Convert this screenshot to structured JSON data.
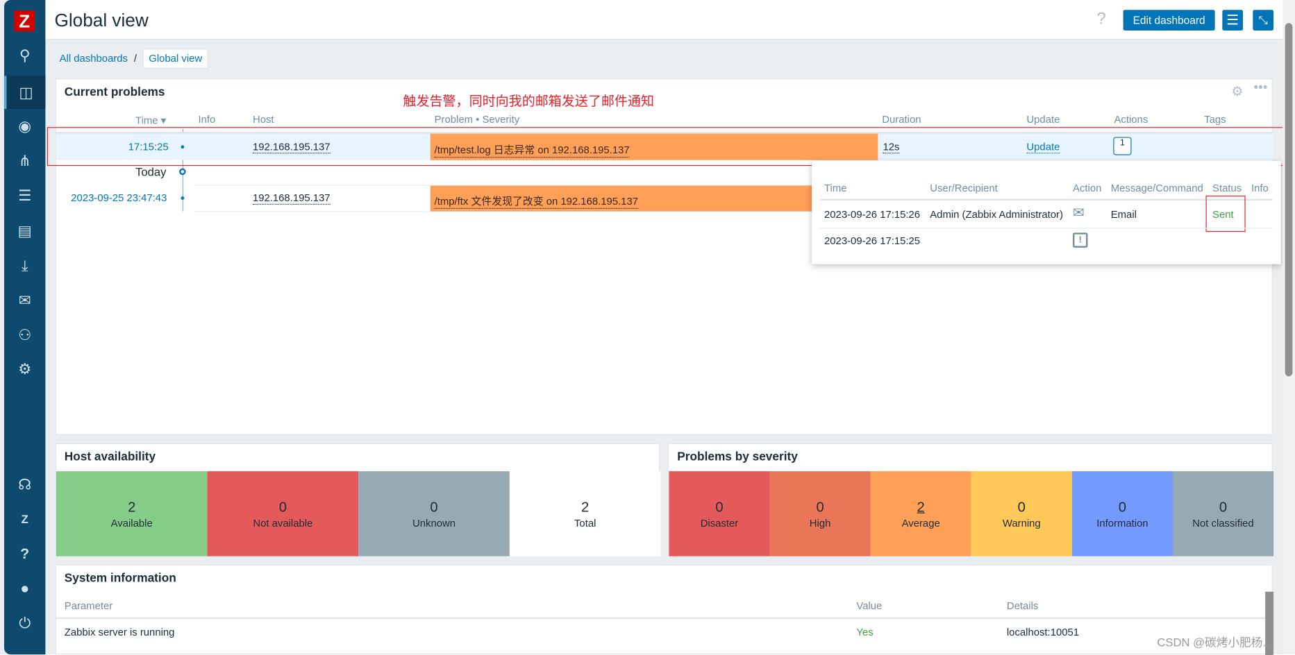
{
  "sidebar": {
    "logo": "Z",
    "items": [
      "search-icon",
      "dashboards-icon",
      "monitoring-icon",
      "network-icon",
      "inventory-icon",
      "reports-icon",
      "data-collection-icon",
      "alerts-icon",
      "users-icon",
      "administration-icon"
    ],
    "bottom": [
      "support-icon",
      "integrations-icon",
      "help-icon",
      "user-settings-icon",
      "sign-out-icon"
    ]
  },
  "header": {
    "title": "Global view",
    "help": "?",
    "edit_label": "Edit dashboard"
  },
  "breadcrumb": {
    "root": "All dashboards",
    "sep": "/",
    "current": "Global view"
  },
  "annotation": "触发告警，同时向我的邮箱发送了邮件通知",
  "problems": {
    "title": "Current problems",
    "columns": [
      "Time ▾",
      "Info",
      "Host",
      "Problem • Severity",
      "Duration",
      "Update",
      "Actions",
      "Tags"
    ],
    "rows": [
      {
        "time": "17:15:25",
        "host": "192.168.195.137",
        "problem": "/tmp/test.log 日志异常 on 192.168.195.137",
        "duration": "12s",
        "update": "Update",
        "actions": "1"
      },
      {
        "time": "2023-09-25 23:47:43",
        "host": "192.168.195.137",
        "problem": "/tmp/ftx 文件发现了改变 on 192.168.195.137"
      }
    ],
    "today": "Today",
    "severity_color": "#ffa059"
  },
  "popup": {
    "columns": [
      "Time",
      "User/Recipient",
      "Action",
      "Message/Command",
      "Status",
      "Info"
    ],
    "rows": [
      {
        "time": "2023-09-26 17:15:26",
        "user": "Admin (Zabbix Administrator)",
        "action": "mail-icon",
        "message": "Email",
        "status": "Sent"
      },
      {
        "time": "2023-09-26 17:15:25",
        "user": "",
        "action": "calendar-alert-icon",
        "message": "",
        "status": ""
      }
    ]
  },
  "host_availability": {
    "title": "Host availability",
    "tiles": [
      {
        "n": "2",
        "label": "Available",
        "color": "#86cc89"
      },
      {
        "n": "0",
        "label": "Not available",
        "color": "#e45959"
      },
      {
        "n": "0",
        "label": "Unknown",
        "color": "#97aab3"
      },
      {
        "n": "2",
        "label": "Total",
        "color": "#ffffff"
      }
    ]
  },
  "severity": {
    "title": "Problems by severity",
    "tiles": [
      {
        "n": "0",
        "label": "Disaster",
        "color": "#e45959"
      },
      {
        "n": "0",
        "label": "High",
        "color": "#e97659"
      },
      {
        "n": "2",
        "label": "Average",
        "color": "#ffa059"
      },
      {
        "n": "0",
        "label": "Warning",
        "color": "#ffc859"
      },
      {
        "n": "0",
        "label": "Information",
        "color": "#7499ff"
      },
      {
        "n": "0",
        "label": "Not classified",
        "color": "#97aab3"
      }
    ]
  },
  "sysinfo": {
    "title": "System information",
    "columns": [
      "Parameter",
      "Value",
      "Details"
    ],
    "rows": [
      {
        "param": "Zabbix server is running",
        "value": "Yes",
        "details": "localhost:10051"
      }
    ]
  },
  "watermark": "CSDN @碳烤小肥杨..."
}
